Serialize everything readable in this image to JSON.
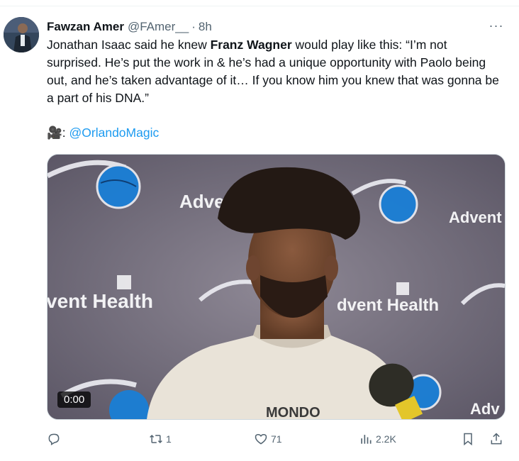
{
  "author": {
    "name": "Fawzan Amer",
    "handle": "@FAmer__",
    "separator": "·",
    "time": "8h"
  },
  "more_label": "···",
  "tweet": {
    "text_before": "Jonathan Isaac said he knew ",
    "bold": "Franz Wagner",
    "text_after": " would play like this: “I’m not surprised. He’s put the work in & he’s had a unique opportunity with Paolo being out, and he’s taken advantage of it… If you know him you knew that was gonna be a part of his DNA.”",
    "credit_prefix": "🎥: ",
    "credit_mention": "@OrlandoMagic"
  },
  "media": {
    "backdrop_text_1": "Adven",
    "backdrop_text_2": "Advent",
    "backdrop_text_3": "vent Health",
    "backdrop_text_4": "dvent Health",
    "backdrop_text_5": "Adv",
    "shirt_text": "MONDO",
    "video_time": "0:00"
  },
  "actions": {
    "reply_count": "",
    "retweet_count": "1",
    "like_count": "71",
    "views_count": "2.2K"
  },
  "colors": {
    "accent": "#1d9bf0",
    "muted": "#536471",
    "text": "#0f1419"
  }
}
